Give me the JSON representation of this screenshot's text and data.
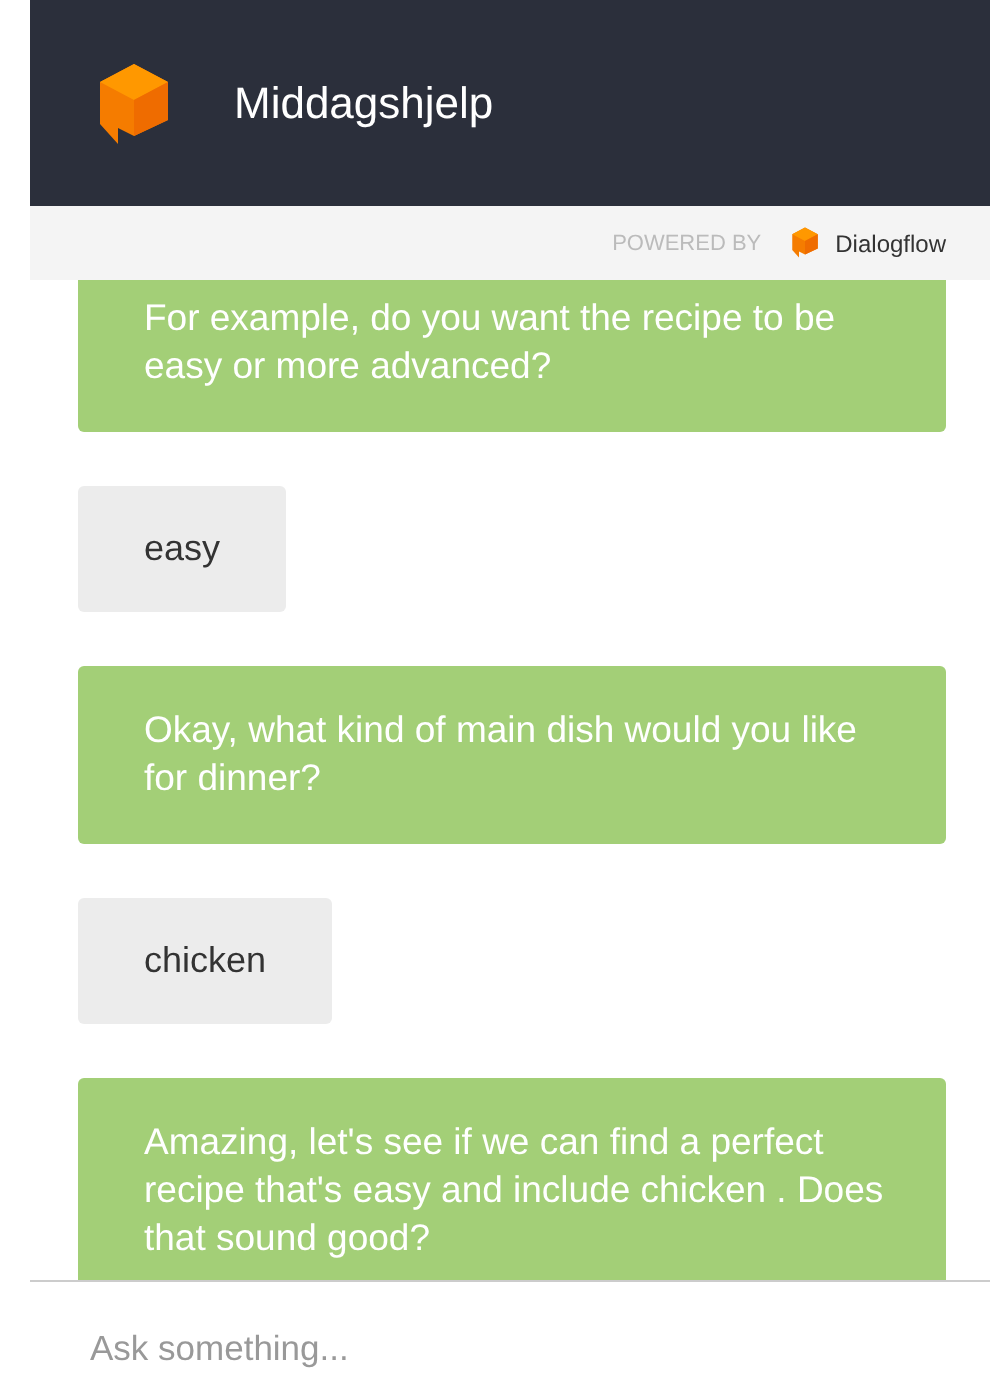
{
  "header": {
    "title": "Middagshjelp"
  },
  "powered_by": {
    "label": "POWERED BY",
    "brand": "Dialogflow"
  },
  "messages": [
    {
      "kind": "bot",
      "text": "For example, do you want the recipe to be easy or more advanced?"
    },
    {
      "kind": "user",
      "text": "easy"
    },
    {
      "kind": "bot",
      "text": "Okay, what kind of main dish would you like for dinner?"
    },
    {
      "kind": "user",
      "text": "chicken"
    },
    {
      "kind": "bot",
      "text": "Amazing, let's see if we can find a perfect recipe that's easy and include chicken . Does that sound good?"
    }
  ],
  "input": {
    "placeholder": "Ask something..."
  }
}
